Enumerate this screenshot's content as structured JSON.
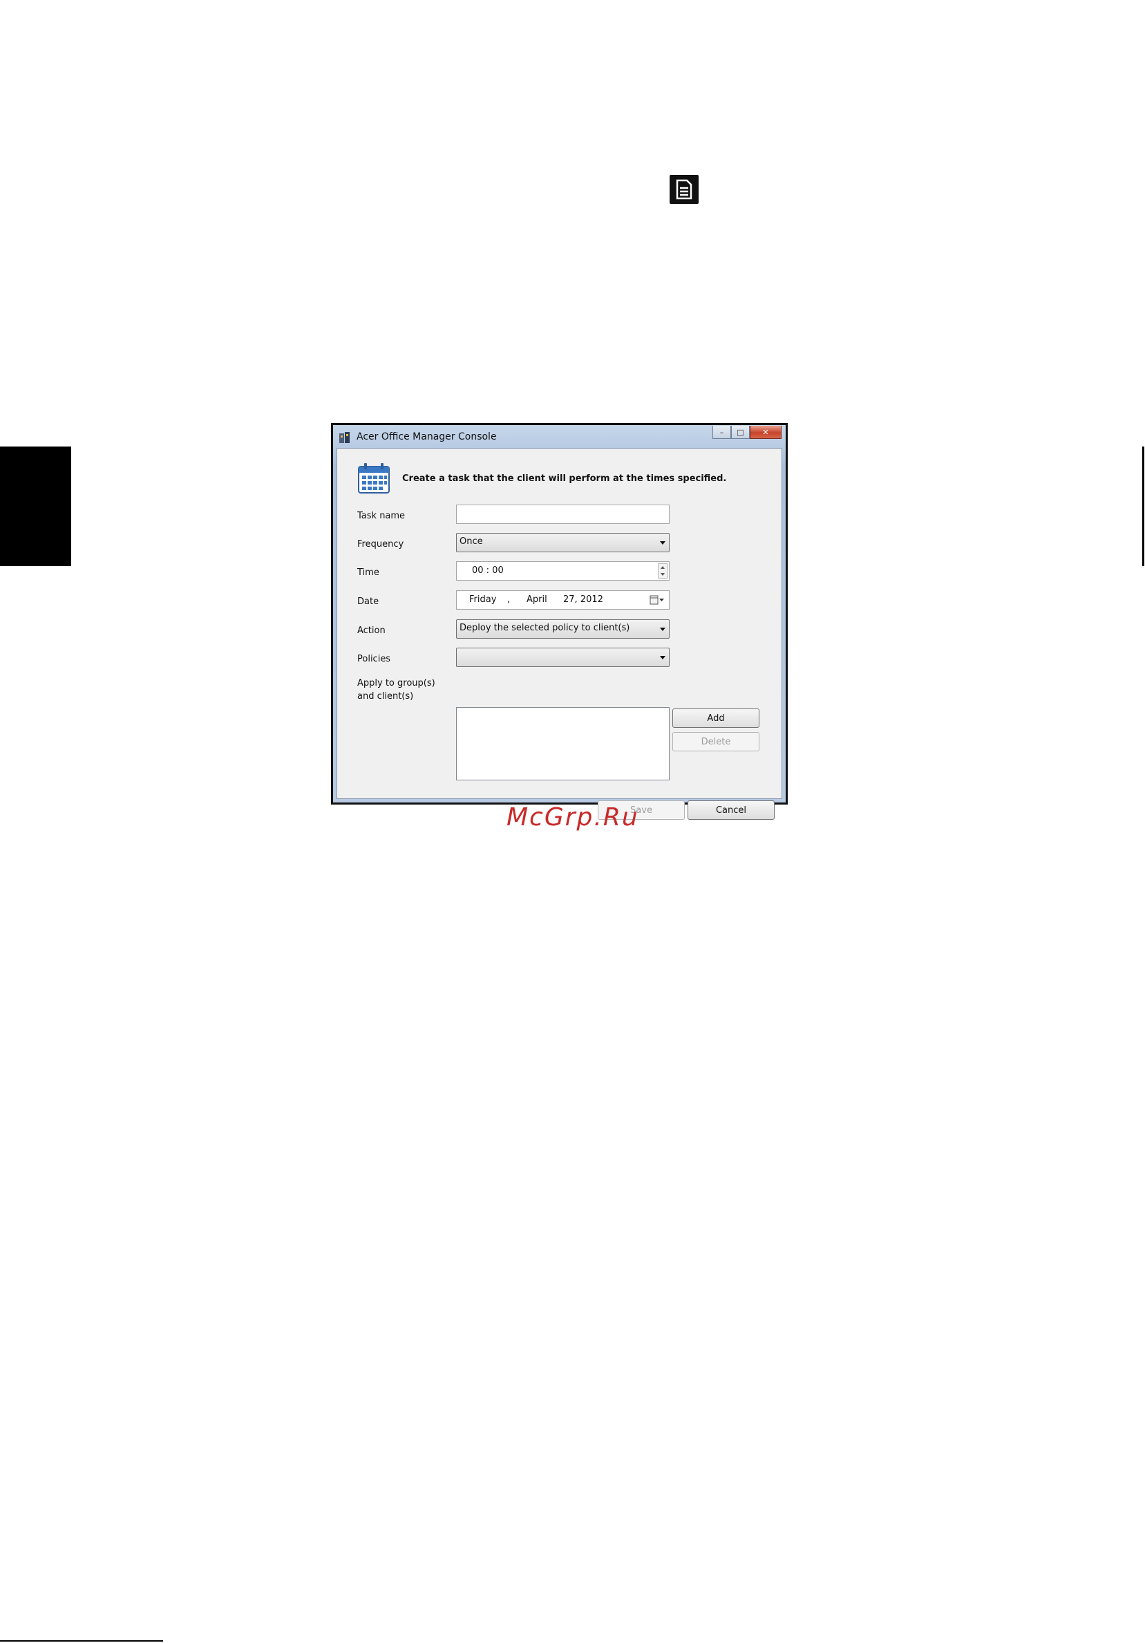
{
  "window": {
    "title": "Acer Office Manager Console",
    "controls": {
      "minimize": "–",
      "maximize": "□",
      "close": "✕"
    }
  },
  "dialog": {
    "header": "Create a task that the client will perform at the times specified.",
    "fields": {
      "task_name": {
        "label": "Task name",
        "value": ""
      },
      "frequency": {
        "label": "Frequency",
        "value": "Once"
      },
      "time": {
        "label": "Time",
        "value": "00 : 00"
      },
      "date": {
        "label": "Date",
        "weekday": "Friday",
        "separator": ",",
        "month": "April",
        "day_year": "27, 2012"
      },
      "action": {
        "label": "Action",
        "value": "Deploy the selected policy to client(s)"
      },
      "policies": {
        "label": "Policies",
        "value": ""
      },
      "apply": {
        "label_line1": "Apply to group(s)",
        "label_line2": "and client(s)"
      }
    },
    "buttons": {
      "add": "Add",
      "delete": "Delete",
      "save": "Save",
      "cancel": "Cancel"
    }
  },
  "watermark": "McGrp.Ru",
  "colors": {
    "watermark": "#c92a2a",
    "window_frame": "#b8cbe3",
    "client_bg": "#f0f0f0"
  }
}
